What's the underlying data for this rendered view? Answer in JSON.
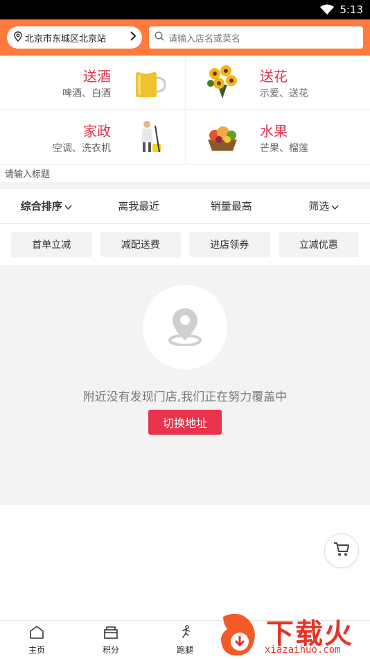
{
  "status_bar": {
    "time": "5:13"
  },
  "top_bar": {
    "location": "北京市东城区北京站",
    "search_placeholder": "请输入店名或菜名"
  },
  "categories": [
    {
      "title": "送酒",
      "subtitle": "啤酒、白酒",
      "icon": "beer-mug-icon"
    },
    {
      "title": "送花",
      "subtitle": "示爱、送花",
      "icon": "sunflower-bouquet-icon"
    },
    {
      "title": "家政",
      "subtitle": "空调、洗衣机",
      "icon": "cleaner-icon"
    },
    {
      "title": "水果",
      "subtitle": "芒果、榴莲",
      "icon": "fruit-basket-icon"
    }
  ],
  "title_placeholder": "请输入标题",
  "sort_bar": {
    "items": [
      "综合排序",
      "离我最近",
      "销量最高",
      "筛选"
    ]
  },
  "promos": [
    "首单立减",
    "减配送费",
    "进店领券",
    "立减优惠"
  ],
  "empty_state": {
    "message": "附近没有发现门店,我们正在努力覆盖中",
    "button": "切换地址"
  },
  "bottom_nav": {
    "items": [
      "主页",
      "积分",
      "跑腿"
    ]
  },
  "watermark": {
    "brand": "下载火",
    "url": "xiazaihuo.com"
  },
  "colors": {
    "header": "#FF7A3B",
    "accent": "#E8334B",
    "watermark": "#E83324"
  }
}
